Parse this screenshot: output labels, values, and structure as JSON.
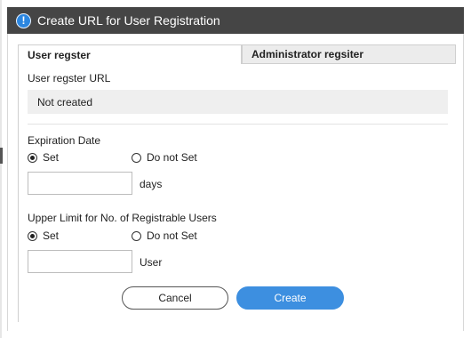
{
  "dialog": {
    "title": "Create URL for User Registration",
    "title_icon": "info-icon",
    "accent_color": "#3d8fe0"
  },
  "tabs": [
    {
      "label": "User regster",
      "active": true
    },
    {
      "label": "Administrator regsiter",
      "active": false
    }
  ],
  "url_section": {
    "label": "User regster URL",
    "value": "Not created"
  },
  "expiration": {
    "label": "Expiration Date",
    "options": [
      {
        "label": "Set",
        "checked": true
      },
      {
        "label": "Do not Set",
        "checked": false
      }
    ],
    "value": "",
    "unit": "days"
  },
  "user_limit": {
    "label": "Upper Limit for No. of Registrable Users",
    "options": [
      {
        "label": "Set",
        "checked": true
      },
      {
        "label": "Do not Set",
        "checked": false
      }
    ],
    "value": "",
    "unit": "User"
  },
  "buttons": {
    "cancel": "Cancel",
    "create": "Create"
  }
}
